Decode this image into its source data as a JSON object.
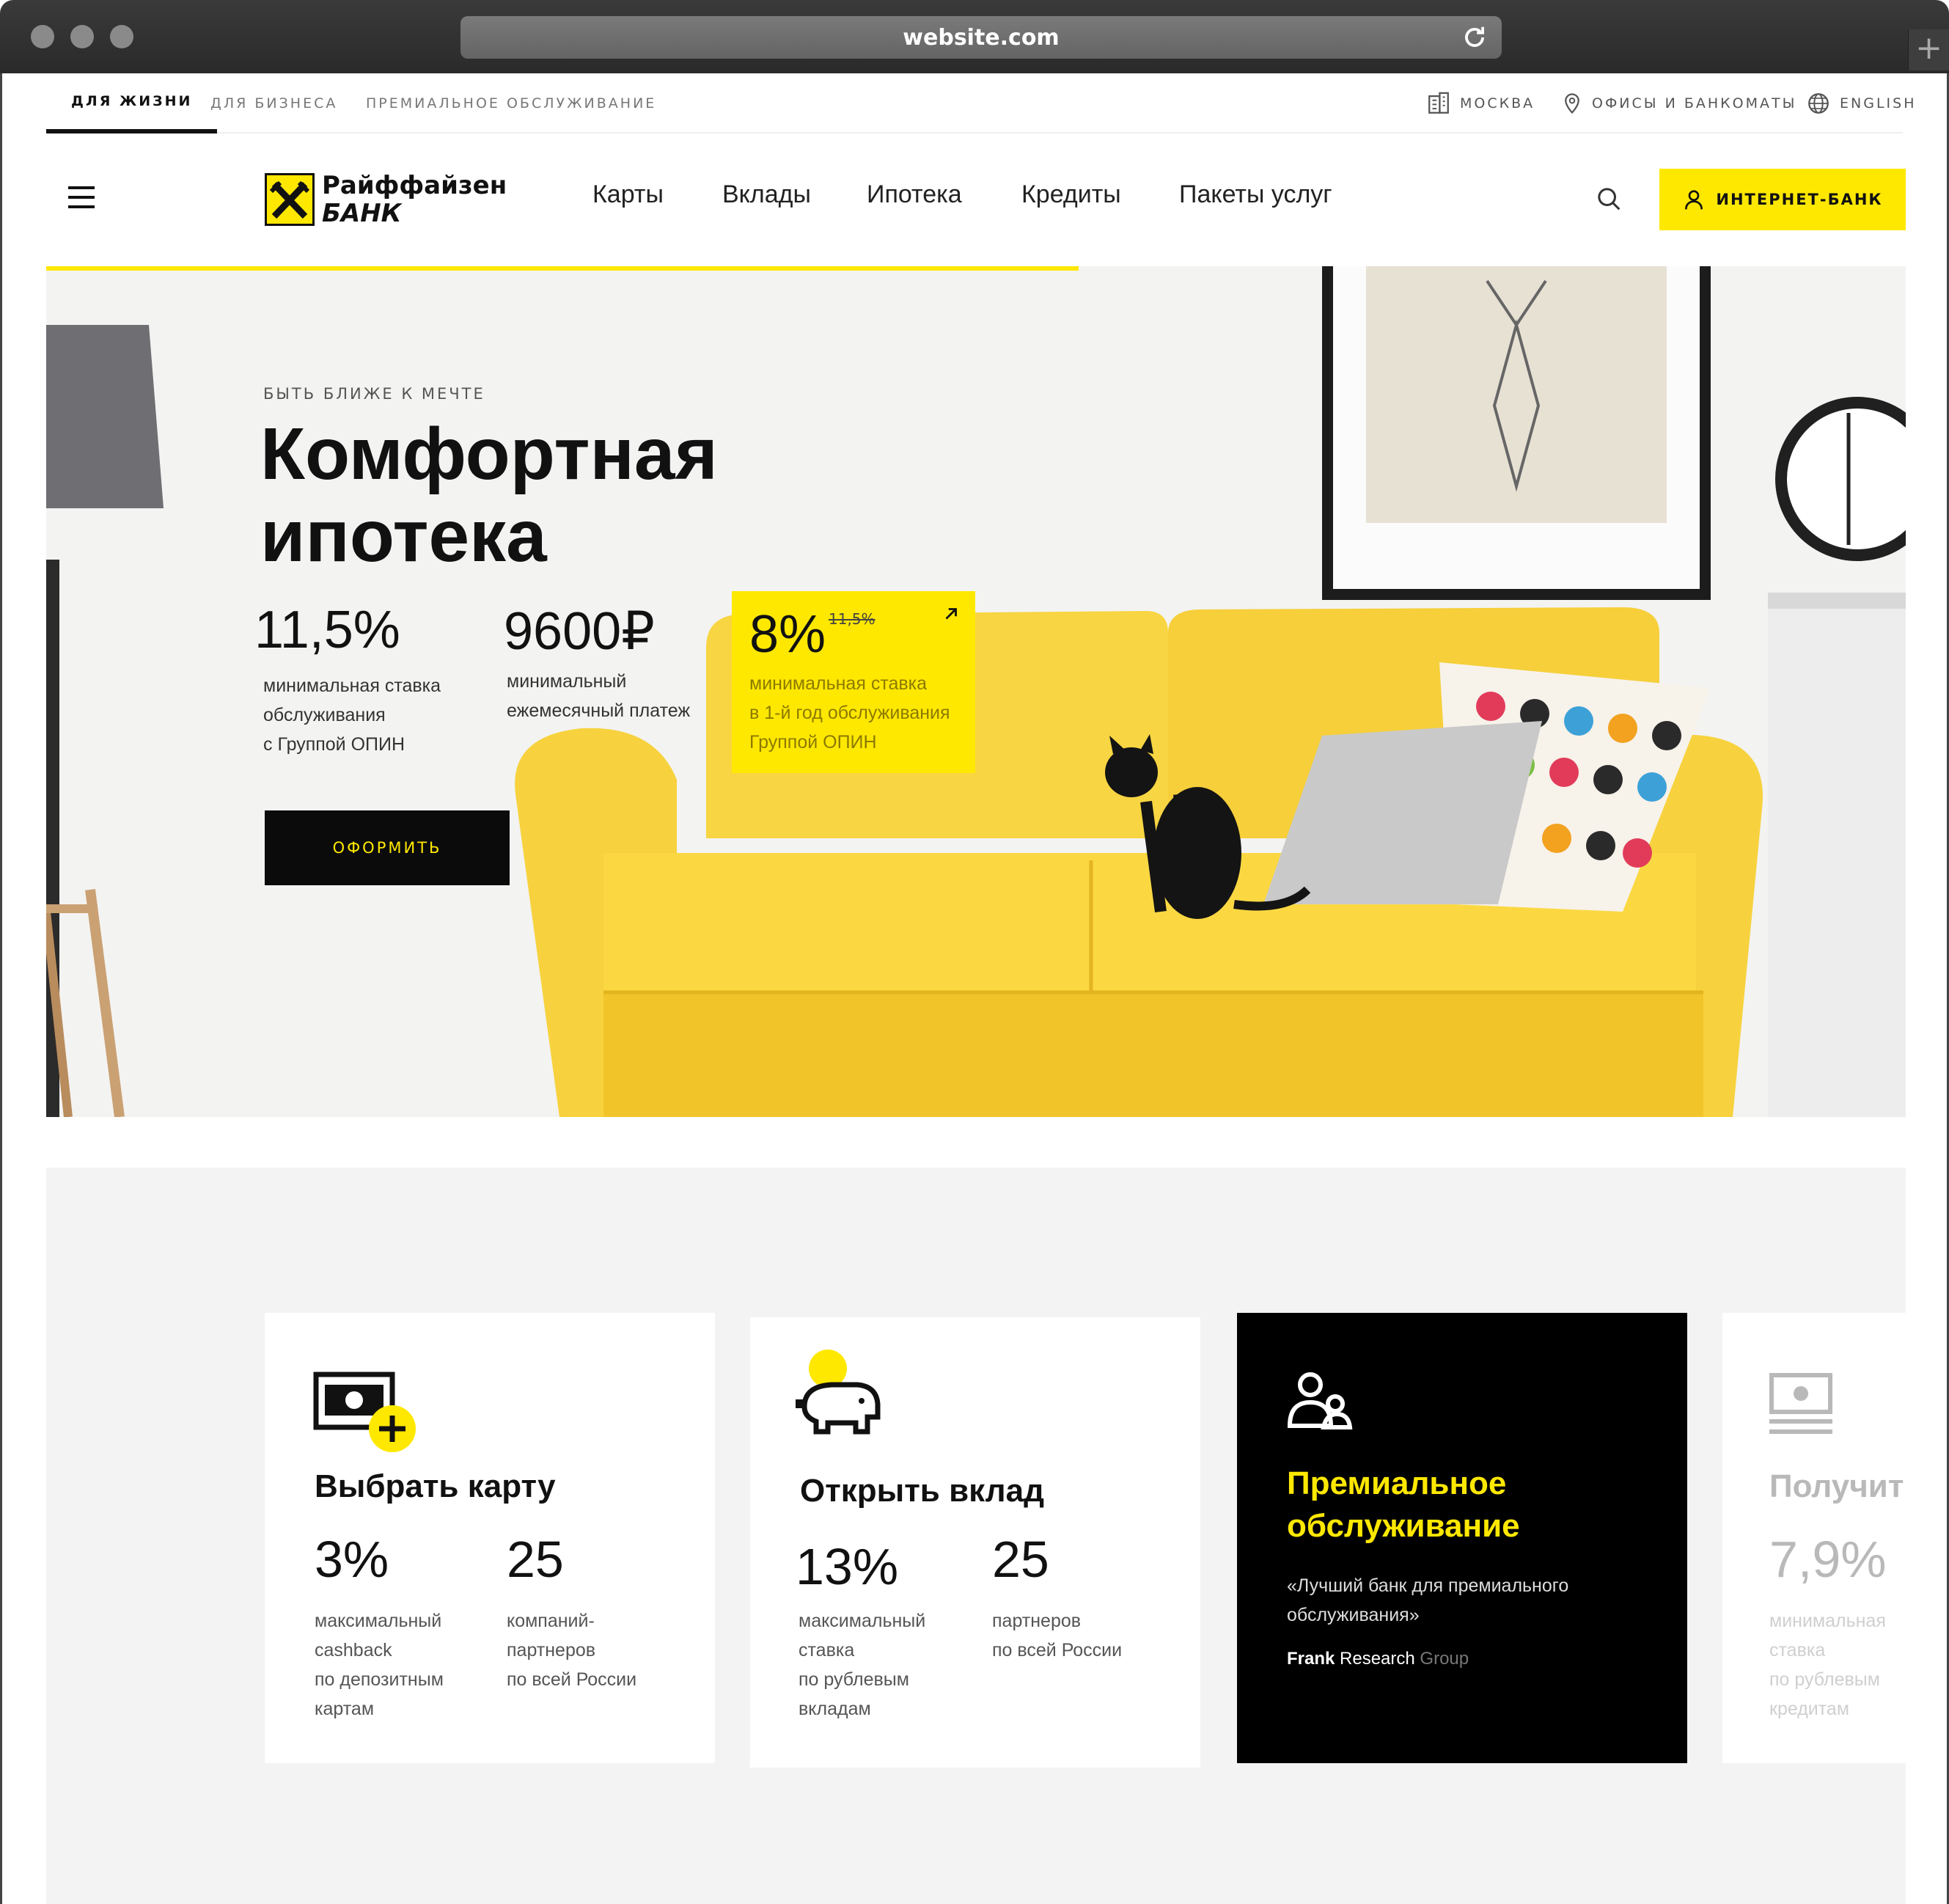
{
  "browser": {
    "url": "website.com",
    "new_tab": "+"
  },
  "topnav": {
    "tabs": [
      "ДЛЯ ЖИЗНИ",
      "ДЛЯ БИЗНЕСА",
      "ПРЕМИАЛЬНОЕ ОБСЛУЖИВАНИЕ"
    ],
    "city": "МОСКВА",
    "offices": "ОФИСЫ И БАНКОМАТЫ",
    "language": "ENGLISH"
  },
  "header": {
    "logo_line1": "Райффайзен",
    "logo_line2": "БАНК",
    "menu": [
      "Карты",
      "Вклады",
      "Ипотека",
      "Кредиты",
      "Пакеты услуг"
    ],
    "internet_bank": "ИНТЕРНЕТ-БАНК"
  },
  "hero": {
    "eyebrow": "БЫТЬ БЛИЖЕ К МЕЧТЕ",
    "title_line1": "Комфортная",
    "title_line2": "ипотека",
    "stats": [
      {
        "value": "11,5%",
        "desc": [
          "минимальная ставка",
          "обслуживания",
          "с Группой ОПИН"
        ]
      },
      {
        "value": "9600₽",
        "desc": [
          "минимальный",
          "ежемесячный платеж"
        ]
      }
    ],
    "promo": {
      "value": "8%",
      "old_value": "11,5%",
      "desc": [
        "минимальная ставка",
        "в 1-й год обслуживания",
        "Группой ОПИН"
      ]
    },
    "cta": "ОФОРМИТЬ"
  },
  "cards": [
    {
      "title": "Выбрать карту",
      "stats": [
        {
          "value": "3%",
          "desc": [
            "максимальный",
            "cashback",
            "по депозитным",
            "картам"
          ]
        },
        {
          "value": "25",
          "desc": [
            "компаний-",
            "партнеров",
            "по всей России"
          ]
        }
      ]
    },
    {
      "title": "Открыть вклад",
      "stats": [
        {
          "value": "13%",
          "desc": [
            "максимальный",
            "ставка",
            "по рублевым",
            "вкладам"
          ]
        },
        {
          "value": "25",
          "desc": [
            "партнеров",
            "по всей России"
          ]
        }
      ]
    },
    {
      "title_line1": "Премиальное",
      "title_line2": "обслуживание",
      "quote_line1": "«Лучший банк для премиального",
      "quote_line2": "обслуживания»",
      "source_a": "Frank",
      "source_b": "Research",
      "source_c": "Group"
    },
    {
      "title": "Получит",
      "stats": [
        {
          "value": "7,9%",
          "desc": [
            "минимальная",
            "ставка",
            "по рублевым",
            "кредитам"
          ]
        }
      ]
    }
  ],
  "colors": {
    "accent": "#ffe800",
    "dark": "#000000",
    "section_bg": "#f3f3f3"
  }
}
